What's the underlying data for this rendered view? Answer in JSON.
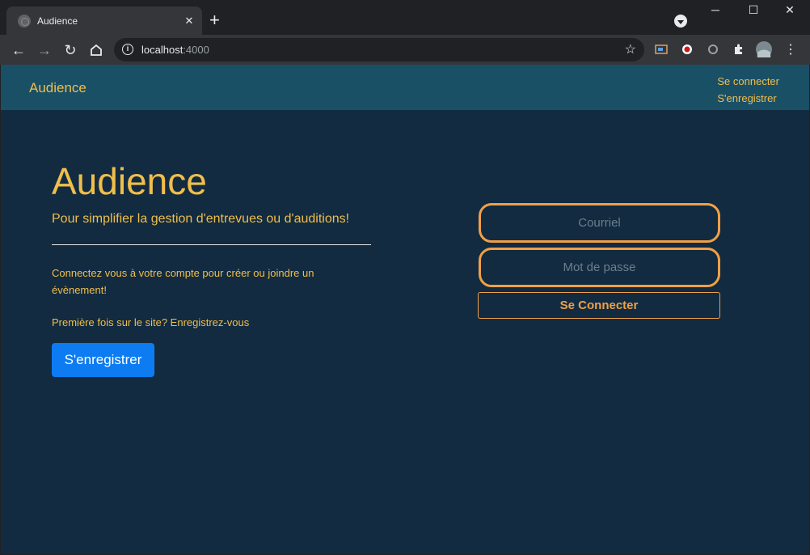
{
  "browser": {
    "tab_title": "Audience",
    "url_host": "localhost",
    "url_port": ":4000",
    "icons": [
      "back-icon",
      "forward-icon",
      "reload-icon",
      "home-icon",
      "info-icon",
      "bookmark-star-icon",
      "extensions-icon",
      "menu-icon"
    ]
  },
  "site": {
    "brand": "Audience",
    "nav": {
      "login": "Se connecter",
      "register": "S'enregistrer"
    }
  },
  "hero": {
    "title": "Audience",
    "subtitle": "Pour simplifier la gestion d'entrevues ou d'auditions!",
    "paragraph1": "Connectez vous à votre compte pour créer ou joindre un évènement!",
    "paragraph2": "Première fois sur le site? Enregistrez-vous",
    "register_button": "S'enregistrer"
  },
  "login_form": {
    "email_placeholder": "Courriel",
    "password_placeholder": "Mot de passe",
    "submit_label": "Se Connecter"
  },
  "colors": {
    "page_bg": "#122b40",
    "navbar_bg": "#1a5066",
    "accent_yellow": "#f0be4b",
    "accent_orange": "#f0a047",
    "primary_button": "#0d7cf2"
  }
}
